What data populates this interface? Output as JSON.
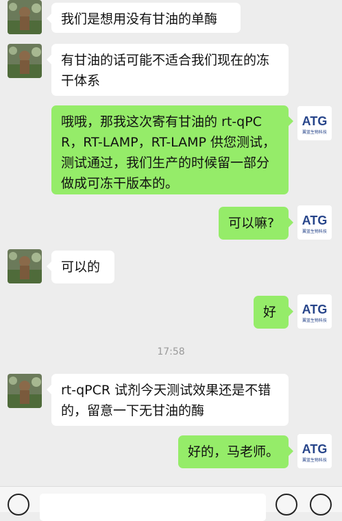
{
  "messages": [
    {
      "side": "in",
      "text": "我们是想用没有甘油的单酶"
    },
    {
      "side": "in",
      "text": "有甘油的话可能不适合我们现在的冻干体系"
    },
    {
      "side": "out",
      "text": "哦哦，那我这次寄有甘油的 rt-qPCR，RT-LAMP，RT-LAMP 供您测试，测试通过，我们生产的时候留一部分做成可冻干版本的。"
    },
    {
      "side": "out",
      "text": "可以嘛?"
    },
    {
      "side": "in",
      "text": "可以的"
    },
    {
      "side": "out",
      "text": "好"
    },
    {
      "side": "in",
      "text": "rt-qPCR 试剂今天测试效果还是不错的，留意一下无甘油的酶"
    },
    {
      "side": "out",
      "text": "好的，马老师。"
    }
  ],
  "timestamp": "17:58",
  "logo": {
    "main": "ATG",
    "sub": "翼蓝生物科技"
  },
  "colors": {
    "outgoing": "#95ec69",
    "incoming": "#ffffff",
    "background": "#ededed"
  },
  "icons": {
    "voice": "voice-icon",
    "emoji": "emoji-icon",
    "plus": "plus-icon"
  }
}
